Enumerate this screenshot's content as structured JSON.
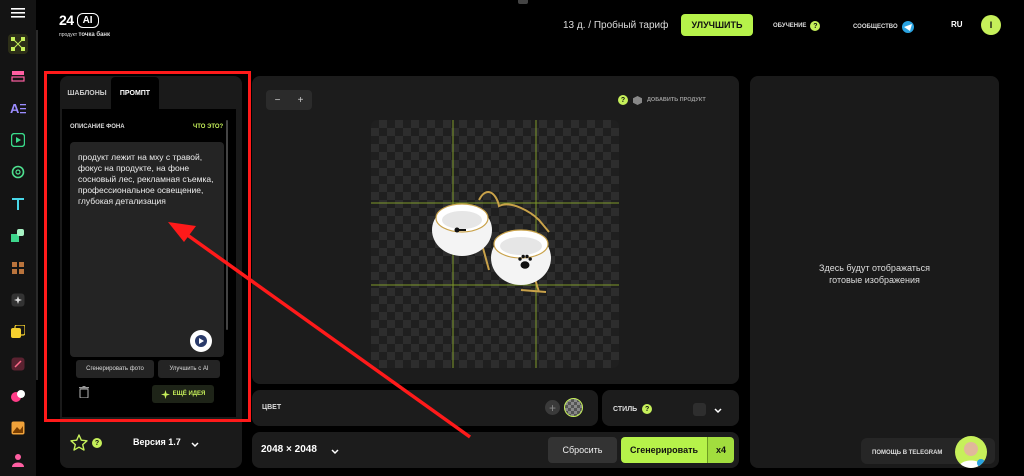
{
  "header": {
    "logo_number": "24",
    "logo_ai": "AI",
    "logo_sub_prefix": "продукт",
    "logo_sub_brand": "точка банк",
    "plan": "13 д.  /  Пробный тариф",
    "upgrade_label": "УЛУЧШИТЬ",
    "learn_label": "ОБУЧЕНИЕ",
    "community_label": "СООБЩЕСТВО",
    "language": "RU",
    "avatar_letter": "I",
    "help_glyph": "?"
  },
  "sidebar": {
    "icons": [
      "menu-icon",
      "nodes-icon",
      "layers-icon",
      "text-effects-icon",
      "video-icon",
      "openai-icon",
      "text-icon",
      "shapes-icon",
      "grid-icon",
      "sparkle-icon",
      "stack-icon",
      "image-edit-icon",
      "palette-icon",
      "gallery-icon",
      "person-icon"
    ]
  },
  "left_panel": {
    "tabs": [
      "ШАБЛОНЫ",
      "ПРОМПТ"
    ],
    "active_tab": "ПРОМПТ",
    "section_label": "ОПИСАНИЕ ФОНА",
    "whats_this": "ЧТО ЭТО?",
    "prompt_text": "продукт лежит на мху с травой, фокус на продукте, на фоне сосновый лес, рекламная съемка, профессиональное освещение, глубокая детализация",
    "generate_photo": "Сгенерировать фото",
    "improve_ai": "Улучшить с AI",
    "more_ideas": "ЕЩЁ ИДЕЯ",
    "version": "Версия 1.7"
  },
  "canvas": {
    "zoom_out": "−",
    "zoom_in": "+",
    "add_product": "ДОБАВИТЬ ПРОДУКТ",
    "color_label": "ЦВЕТ",
    "style_label": "СТИЛЬ",
    "size": "2048 × 2048",
    "reset": "Сбросить",
    "generate": "Сгенерировать",
    "multiplier": "x4"
  },
  "results": {
    "empty_text_line1": "Здесь будут отображаться",
    "empty_text_line2": "готовые изображения",
    "telegram_help": "ПОМОЩЬ В TELEGRAM"
  },
  "colors": {
    "accent": "#b6f24a",
    "annotation": "#ff1a1a",
    "panel": "#1c1c1c"
  }
}
